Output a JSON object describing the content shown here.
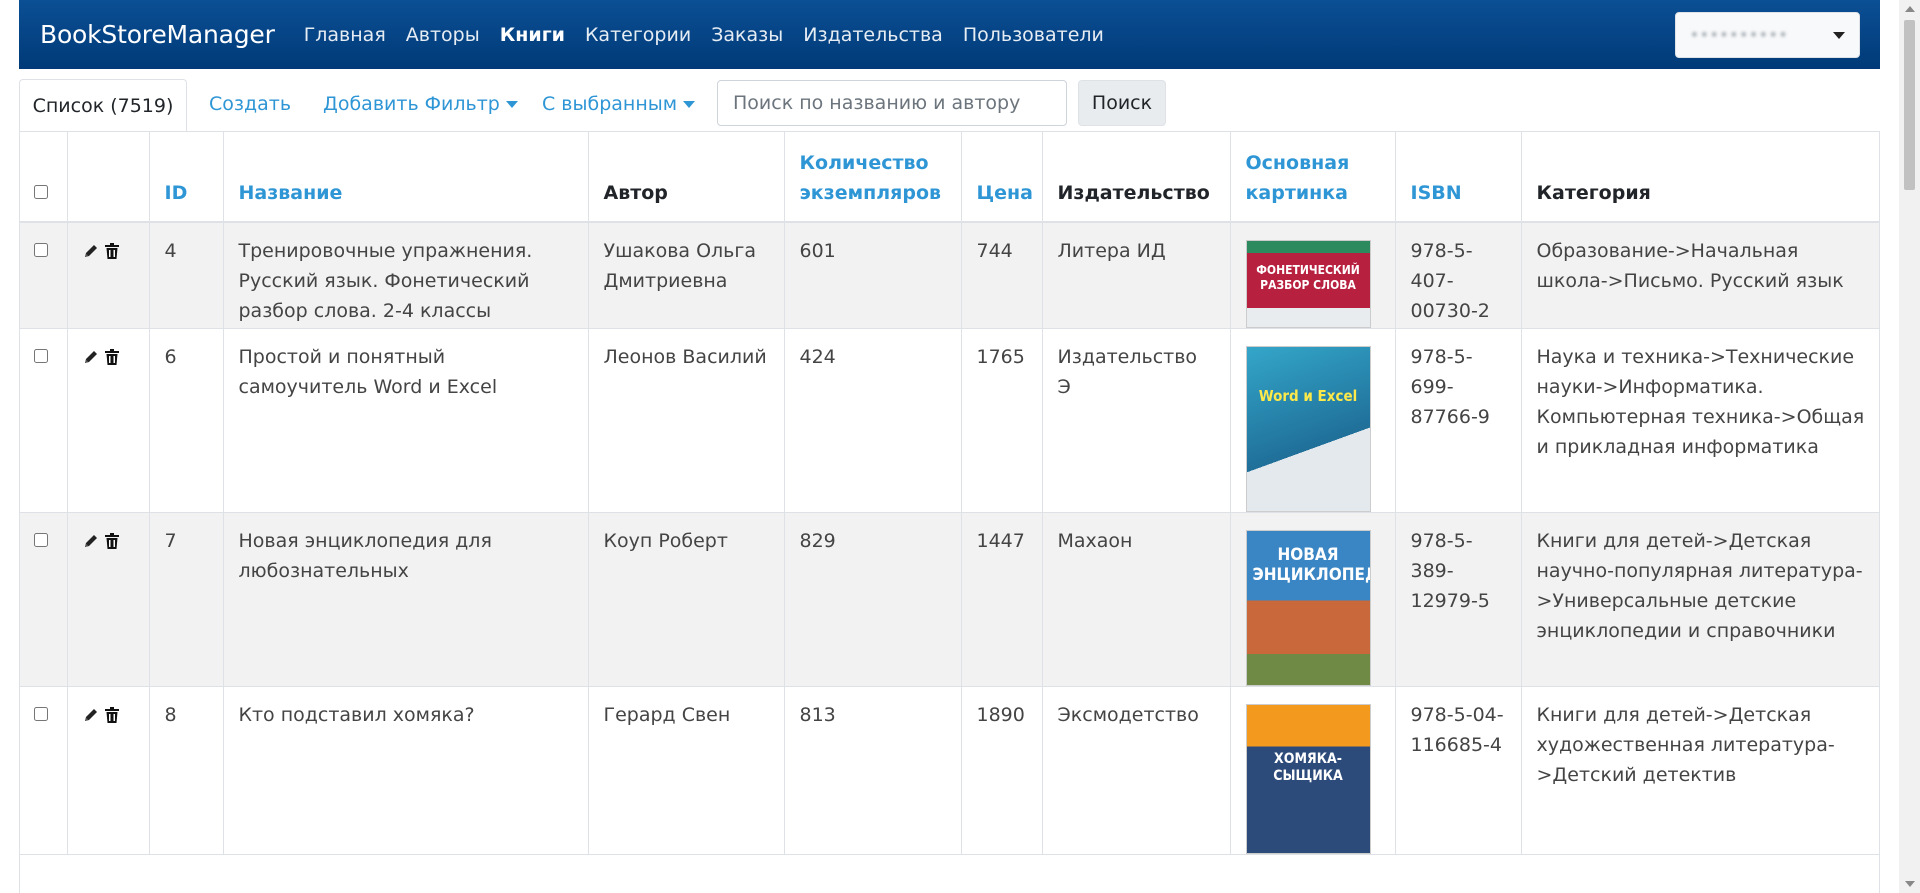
{
  "navbar": {
    "brand": "BookStoreManager",
    "links": [
      "Главная",
      "Авторы",
      "Книги",
      "Категории",
      "Заказы",
      "Издательства",
      "Пользователи"
    ],
    "active_index": 2,
    "user_name": "••••••••••"
  },
  "toolbar": {
    "list_tab": "Список (7519)",
    "create": "Создать",
    "add_filter": "Добавить Фильтр",
    "with_selected": "С выбранным",
    "search_placeholder": "Поиск по названию и автору",
    "search_button": "Поиск"
  },
  "table": {
    "headers": {
      "id": "ID",
      "title": "Название",
      "author": "Автор",
      "qty": "Количество экземпляров",
      "price": "Цена",
      "publisher": "Издательство",
      "image": "Основная картинка",
      "isbn": "ISBN",
      "category": "Категория"
    },
    "rows": [
      {
        "id": "4",
        "title": "Тренировочные упражнения. Русский язык. Фонетический разбор слова. 2-4 классы",
        "author": "Ушакова Ольга Дмитриевна",
        "qty": "601",
        "price": "744",
        "publisher": "Литера ИД",
        "isbn": "978-5-407-00730-2",
        "category": "Образование->Начальная школа->Письмо. Русский язык",
        "cover_text": "ФОНЕТИЧЕСКИЙ РАЗБОР СЛОВА"
      },
      {
        "id": "6",
        "title": "Простой и понятный самоучитель Word и Excel",
        "author": "Леонов Василий",
        "qty": "424",
        "price": "1765",
        "publisher": "Издательство Э",
        "isbn": "978-5-699-87766-9",
        "category": "Наука и техника->Технические науки->Информатика. Компьютерная техника->Общая и прикладная информатика",
        "cover_text": "Word и Excel"
      },
      {
        "id": "7",
        "title": "Новая энциклопедия для любознательных",
        "author": "Коуп Роберт",
        "qty": "829",
        "price": "1447",
        "publisher": "Махаон",
        "isbn": "978-5-389-12979-5",
        "category": "Книги для детей->Детская научно-популярная литература->Универсальные детские энциклопедии и справочники",
        "cover_text": "НОВАЯ ЭНЦИКЛОПЕДИЯ"
      },
      {
        "id": "8",
        "title": "Кто подставил хомяка?",
        "author": "Герард Свен",
        "qty": "813",
        "price": "1890",
        "publisher": "Эксмодетство",
        "isbn": "978-5-04-116685-4",
        "category": "Книги для детей->Детская художественная литература->Детский детектив",
        "cover_text": "ХОМЯКА-СЫЩИКА"
      }
    ]
  }
}
